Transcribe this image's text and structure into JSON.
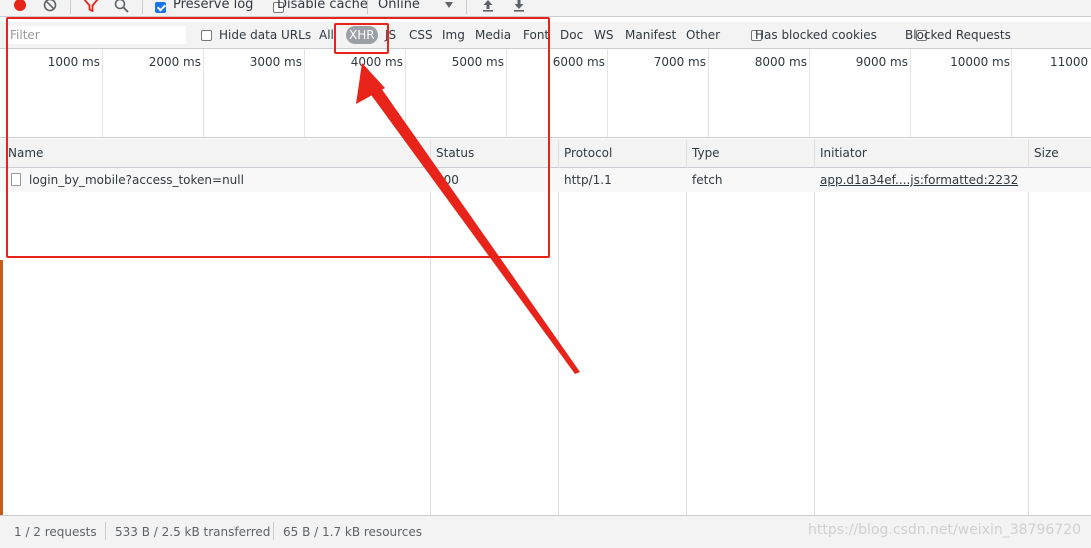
{
  "toolbar": {
    "record_icon": "record-icon",
    "clear_icon": "clear-icon",
    "filter_icon": "filter-icon",
    "search_icon": "search-icon",
    "preserve_log_label": "Preserve log",
    "preserve_log_checked": true,
    "disable_cache_label": "Disable cache",
    "disable_cache_checked": false,
    "throttling_value": "Online",
    "import_icon": "import-har-icon",
    "export_icon": "export-har-icon",
    "colors": {
      "record": "#e8231a",
      "filter_active": "#e8231a"
    }
  },
  "filterbar": {
    "filter_placeholder": "Filter",
    "hide_data_urls_label": "Hide data URLs",
    "types": [
      "All",
      "XHR",
      "JS",
      "CSS",
      "Img",
      "Media",
      "Font",
      "Doc",
      "WS",
      "Manifest",
      "Other"
    ],
    "active_type": "XHR",
    "has_blocked_cookies_label": "Has blocked cookies",
    "blocked_requests_label": "Blocked Requests"
  },
  "overview": {
    "ticks": [
      "1000 ms",
      "2000 ms",
      "3000 ms",
      "4000 ms",
      "5000 ms",
      "6000 ms",
      "7000 ms",
      "8000 ms",
      "9000 ms",
      "10000 ms",
      "11000"
    ]
  },
  "table": {
    "columns": [
      "Name",
      "Status",
      "Protocol",
      "Type",
      "Initiator",
      "Size"
    ],
    "rows": [
      {
        "name": "login_by_mobile?access_token=null",
        "status": "200",
        "protocol": "http/1.1",
        "type": "fetch",
        "initiator": "app.d1a34ef....js:formatted:2232",
        "size": ""
      }
    ]
  },
  "statusbar": {
    "requests": "1 / 2 requests",
    "transferred": "533 B / 2.5 kB transferred",
    "resources": "65 B / 1.7 kB resources"
  },
  "watermark": "https://blog.csdn.net/weixin_38796720",
  "annotation": {
    "color": "#e8231a"
  }
}
